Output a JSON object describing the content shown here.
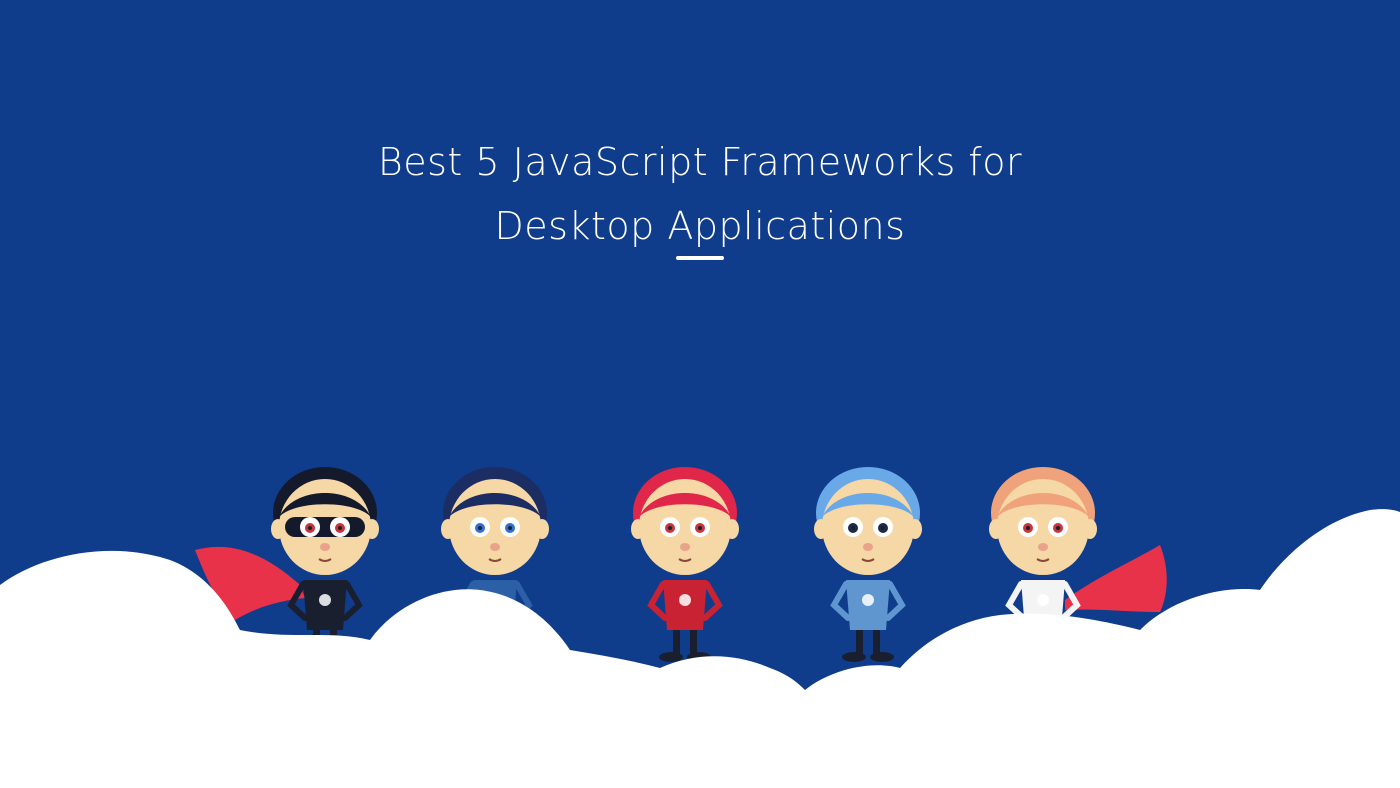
{
  "banner": {
    "title_line1": "Best 5 JavaScript Frameworks for",
    "title_line2": "Desktop Applications"
  },
  "colors": {
    "background": "#0f3d8c",
    "cloud": "#ffffff",
    "cape": "#e8324a",
    "skin": "#f6d7a6"
  },
  "characters": [
    {
      "hair": "#141a2c",
      "shirt": "#1a1f30",
      "eyes": "#c7343c",
      "cape": true,
      "mask": true
    },
    {
      "hair": "#1b2d63",
      "shirt": "#2b5fa6",
      "eyes": "#2f6fd6",
      "cape": false,
      "mask": false
    },
    {
      "hair": "#e0274a",
      "shirt": "#c92232",
      "eyes": "#c7343c",
      "cape": false,
      "mask": false
    },
    {
      "hair": "#6aa9e8",
      "shirt": "#5f96cf",
      "eyes": "#1d2a44",
      "cape": false,
      "mask": false
    },
    {
      "hair": "#f0a37a",
      "shirt": "#f4f4f4",
      "eyes": "#c7343c",
      "cape": true,
      "mask": false
    }
  ]
}
